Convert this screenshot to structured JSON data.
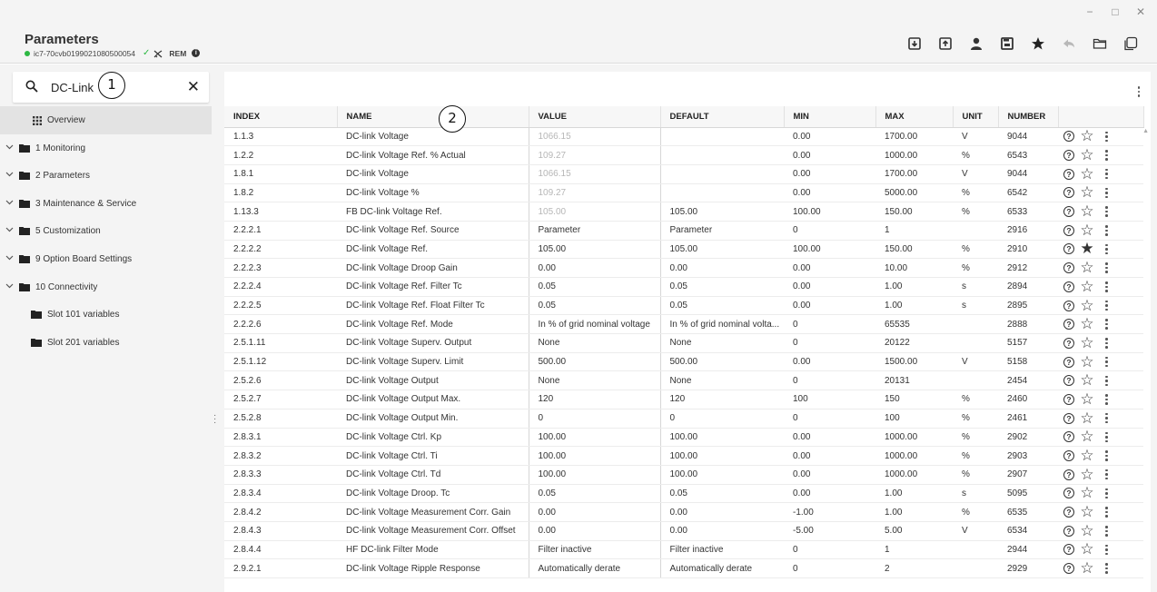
{
  "window": {
    "minimize": "−",
    "maximize": "□",
    "close": "✕"
  },
  "header": {
    "title": "Parameters",
    "device_id": "ic7-70cvb0199021080500054",
    "check": "✓",
    "rem_label": "REM",
    "info": "i"
  },
  "toolbar": {
    "icons": [
      "download-icon",
      "upload-icon",
      "user-icon",
      "save-icon",
      "star-icon",
      "undo-icon",
      "folder-icon",
      "copy-icon"
    ]
  },
  "search": {
    "value": "DC-Link",
    "clear": "✕"
  },
  "markers": {
    "m1": "1",
    "m2": "2"
  },
  "sidebar": {
    "overview": "Overview",
    "items": [
      {
        "label": "1 Monitoring"
      },
      {
        "label": "2 Parameters"
      },
      {
        "label": "3 Maintenance & Service"
      },
      {
        "label": "5 Customization"
      },
      {
        "label": "9 Option Board Settings"
      },
      {
        "label": "10 Connectivity"
      }
    ],
    "slots": [
      {
        "label": "Slot 101 variables"
      },
      {
        "label": "Slot 201 variables"
      }
    ]
  },
  "table": {
    "columns": [
      "INDEX",
      "NAME",
      "VALUE",
      "DEFAULT",
      "MIN",
      "MAX",
      "UNIT",
      "NUMBER"
    ],
    "rows": [
      {
        "index": "1.1.3",
        "name": "DC-link Voltage",
        "value": "1066.15",
        "default": "",
        "min": "0.00",
        "max": "1700.00",
        "unit": "V",
        "number": "9044",
        "dim": true,
        "fav": false
      },
      {
        "index": "1.2.2",
        "name": "DC-link Voltage Ref. % Actual",
        "value": "109.27",
        "default": "",
        "min": "0.00",
        "max": "1000.00",
        "unit": "%",
        "number": "6543",
        "dim": true,
        "fav": false
      },
      {
        "index": "1.8.1",
        "name": "DC-link Voltage",
        "value": "1066.15",
        "default": "",
        "min": "0.00",
        "max": "1700.00",
        "unit": "V",
        "number": "9044",
        "dim": true,
        "fav": false
      },
      {
        "index": "1.8.2",
        "name": "DC-link Voltage %",
        "value": "109.27",
        "default": "",
        "min": "0.00",
        "max": "5000.00",
        "unit": "%",
        "number": "6542",
        "dim": true,
        "fav": false
      },
      {
        "index": "1.13.3",
        "name": "FB DC-link Voltage Ref.",
        "value": "105.00",
        "default": "105.00",
        "min": "100.00",
        "max": "150.00",
        "unit": "%",
        "number": "6533",
        "dim": true,
        "fav": false
      },
      {
        "index": "2.2.2.1",
        "name": "DC-link Voltage Ref. Source",
        "value": "Parameter",
        "default": "Parameter",
        "min": "0",
        "max": "1",
        "unit": "",
        "number": "2916",
        "dim": false,
        "fav": false
      },
      {
        "index": "2.2.2.2",
        "name": "DC-link Voltage Ref.",
        "value": "105.00",
        "default": "105.00",
        "min": "100.00",
        "max": "150.00",
        "unit": "%",
        "number": "2910",
        "dim": false,
        "fav": true
      },
      {
        "index": "2.2.2.3",
        "name": "DC-link Voltage Droop Gain",
        "value": "0.00",
        "default": "0.00",
        "min": "0.00",
        "max": "10.00",
        "unit": "%",
        "number": "2912",
        "dim": false,
        "fav": false
      },
      {
        "index": "2.2.2.4",
        "name": "DC-link Voltage Ref. Filter Tc",
        "value": "0.05",
        "default": "0.05",
        "min": "0.00",
        "max": "1.00",
        "unit": "s",
        "number": "2894",
        "dim": false,
        "fav": false
      },
      {
        "index": "2.2.2.5",
        "name": "DC-link Voltage Ref. Float Filter Tc",
        "value": "0.05",
        "default": "0.05",
        "min": "0.00",
        "max": "1.00",
        "unit": "s",
        "number": "2895",
        "dim": false,
        "fav": false
      },
      {
        "index": "2.2.2.6",
        "name": "DC-link Voltage Ref. Mode",
        "value": "In % of grid nominal voltage",
        "default": "In % of grid nominal volta...",
        "min": "0",
        "max": "65535",
        "unit": "",
        "number": "2888",
        "dim": false,
        "fav": false
      },
      {
        "index": "2.5.1.11",
        "name": "DC-link Voltage Superv. Output",
        "value": "None",
        "default": "None",
        "min": "0",
        "max": "20122",
        "unit": "",
        "number": "5157",
        "dim": false,
        "fav": false
      },
      {
        "index": "2.5.1.12",
        "name": "DC-link Voltage Superv. Limit",
        "value": "500.00",
        "default": "500.00",
        "min": "0.00",
        "max": "1500.00",
        "unit": "V",
        "number": "5158",
        "dim": false,
        "fav": false
      },
      {
        "index": "2.5.2.6",
        "name": "DC-link Voltage Output",
        "value": "None",
        "default": "None",
        "min": "0",
        "max": "20131",
        "unit": "",
        "number": "2454",
        "dim": false,
        "fav": false
      },
      {
        "index": "2.5.2.7",
        "name": "DC-link Voltage Output Max.",
        "value": "120",
        "default": "120",
        "min": "100",
        "max": "150",
        "unit": "%",
        "number": "2460",
        "dim": false,
        "fav": false
      },
      {
        "index": "2.5.2.8",
        "name": "DC-link Voltage Output Min.",
        "value": "0",
        "default": "0",
        "min": "0",
        "max": "100",
        "unit": "%",
        "number": "2461",
        "dim": false,
        "fav": false
      },
      {
        "index": "2.8.3.1",
        "name": "DC-link Voltage Ctrl. Kp",
        "value": "100.00",
        "default": "100.00",
        "min": "0.00",
        "max": "1000.00",
        "unit": "%",
        "number": "2902",
        "dim": false,
        "fav": false
      },
      {
        "index": "2.8.3.2",
        "name": "DC-link Voltage Ctrl. Ti",
        "value": "100.00",
        "default": "100.00",
        "min": "0.00",
        "max": "1000.00",
        "unit": "%",
        "number": "2903",
        "dim": false,
        "fav": false
      },
      {
        "index": "2.8.3.3",
        "name": "DC-link Voltage Ctrl. Td",
        "value": "100.00",
        "default": "100.00",
        "min": "0.00",
        "max": "1000.00",
        "unit": "%",
        "number": "2907",
        "dim": false,
        "fav": false
      },
      {
        "index": "2.8.3.4",
        "name": "DC-link Voltage Droop. Tc",
        "value": "0.05",
        "default": "0.05",
        "min": "0.00",
        "max": "1.00",
        "unit": "s",
        "number": "5095",
        "dim": false,
        "fav": false
      },
      {
        "index": "2.8.4.2",
        "name": "DC-link Voltage Measurement Corr. Gain",
        "value": "0.00",
        "default": "0.00",
        "min": "-1.00",
        "max": "1.00",
        "unit": "%",
        "number": "6535",
        "dim": false,
        "fav": false
      },
      {
        "index": "2.8.4.3",
        "name": "DC-link Voltage Measurement Corr. Offset",
        "value": "0.00",
        "default": "0.00",
        "min": "-5.00",
        "max": "5.00",
        "unit": "V",
        "number": "6534",
        "dim": false,
        "fav": false
      },
      {
        "index": "2.8.4.4",
        "name": "HF DC-link Filter Mode",
        "value": "Filter inactive",
        "default": "Filter inactive",
        "min": "0",
        "max": "1",
        "unit": "",
        "number": "2944",
        "dim": false,
        "fav": false
      },
      {
        "index": "2.9.2.1",
        "name": "DC-link Voltage Ripple Response",
        "value": "Automatically derate",
        "default": "Automatically derate",
        "min": "0",
        "max": "2",
        "unit": "",
        "number": "2929",
        "dim": false,
        "fav": false
      }
    ]
  },
  "colors": {
    "status_green": "#2db843",
    "row_dim_text": "#b6b6b6"
  }
}
